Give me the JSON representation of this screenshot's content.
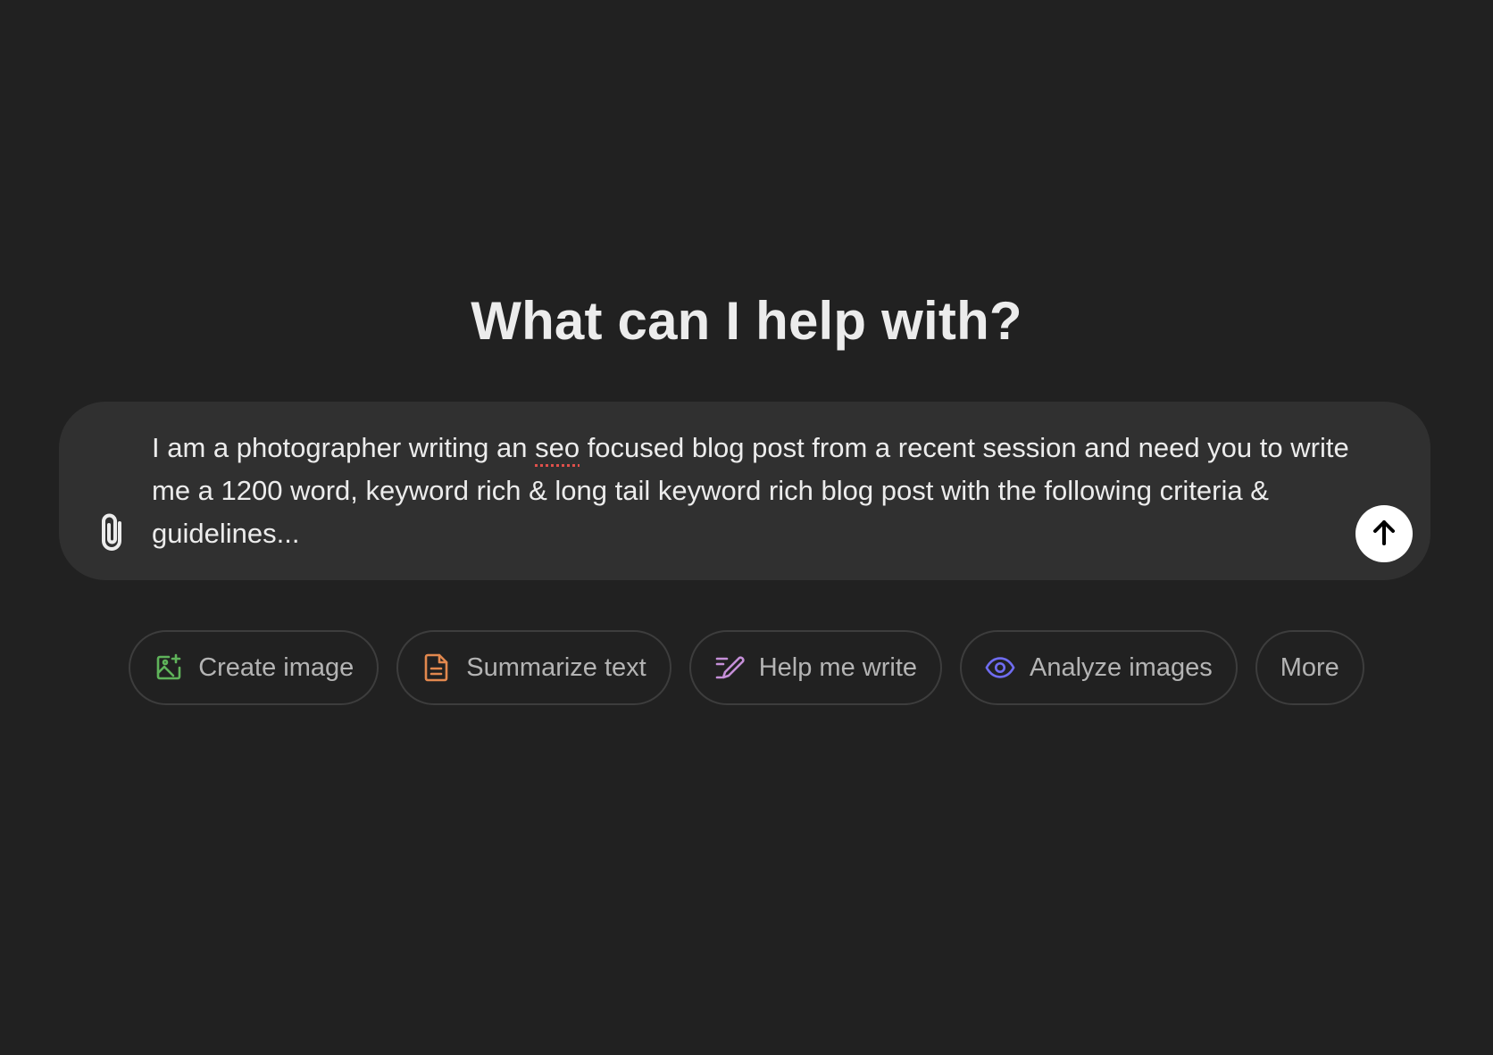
{
  "headline": "What can I help with?",
  "composer": {
    "text_before": "I am a photographer writing an ",
    "text_misspelled": "seo",
    "text_after": " focused blog post from a recent session and need you to write me a 1200 word, keyword rich & long tail keyword rich blog post with the following criteria & guidelines...",
    "attach_icon": "paperclip-icon",
    "send_icon": "arrow-up-icon"
  },
  "chips": [
    {
      "label": "Create image",
      "icon": "image-sparkle-icon",
      "color": "#5fb35a"
    },
    {
      "label": "Summarize text",
      "icon": "document-icon",
      "color": "#e2884e"
    },
    {
      "label": "Help me write",
      "icon": "pen-icon",
      "color": "#c58fd8"
    },
    {
      "label": "Analyze images",
      "icon": "eye-icon",
      "color": "#6f6cf0"
    },
    {
      "label": "More",
      "icon": "",
      "color": ""
    }
  ],
  "colors": {
    "background": "#212121",
    "composer": "#303030",
    "text": "#ececec",
    "chip_text": "#b4b4b4",
    "chip_border": "#3d3d3d"
  }
}
